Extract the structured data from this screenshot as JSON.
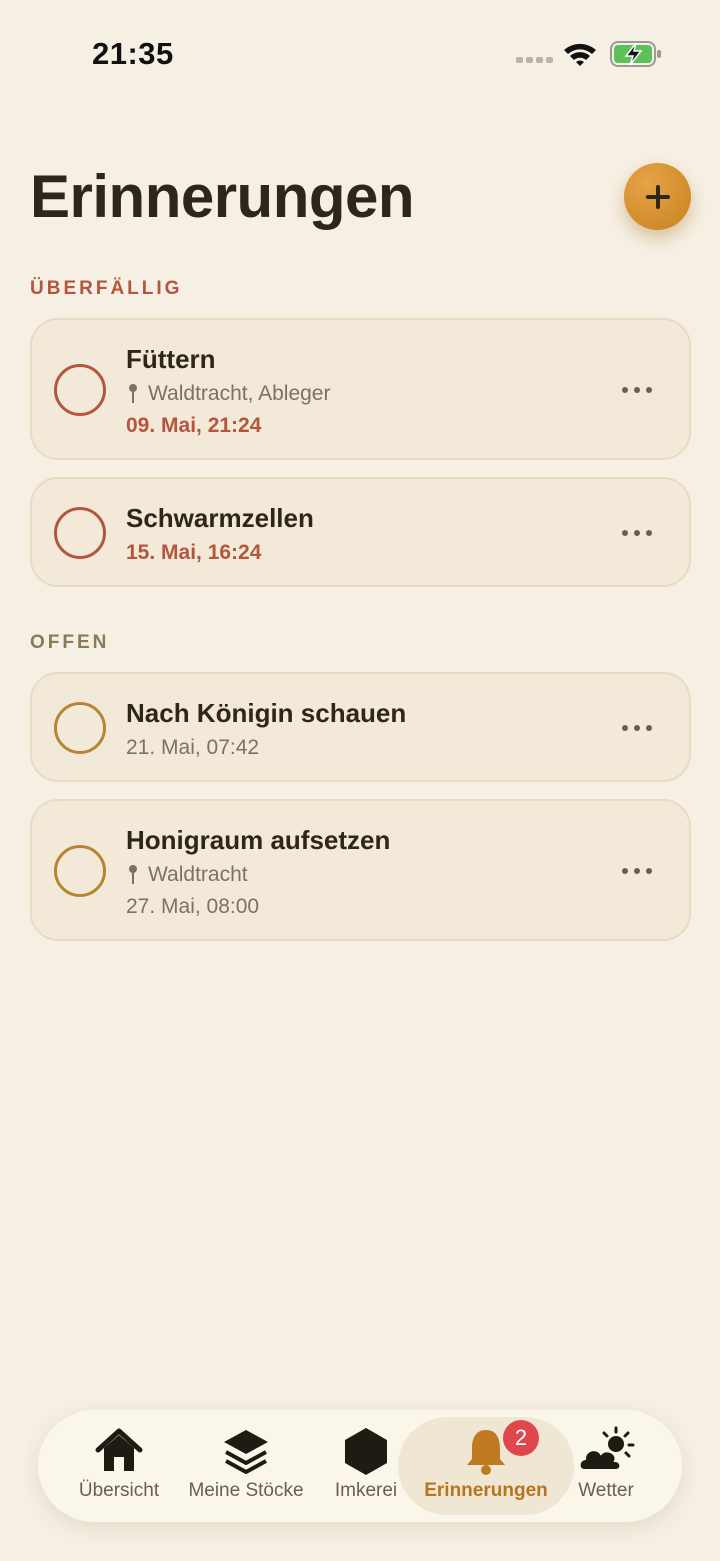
{
  "status_bar": {
    "time": "21:35"
  },
  "header": {
    "title": "Erinnerungen",
    "add_label": "+"
  },
  "sections": {
    "overdue": "ÜBERFÄLLIG",
    "open": "OFFEN"
  },
  "reminders": [
    {
      "title": "Füttern",
      "location": "Waldtracht, Ableger",
      "date": "09. Mai, 21:24",
      "status": "overdue"
    },
    {
      "title": "Schwarmzellen",
      "location": "",
      "date": "15. Mai, 16:24",
      "status": "overdue"
    },
    {
      "title": "Nach Königin schauen",
      "location": "",
      "date": "21. Mai, 07:42",
      "status": "open"
    },
    {
      "title": "Honigraum aufsetzen",
      "location": "Waldtracht",
      "date": "27. Mai, 08:00",
      "status": "open"
    }
  ],
  "tab_bar": {
    "items": [
      {
        "label": "Übersicht",
        "icon": "house-icon"
      },
      {
        "label": "Meine Stöcke",
        "icon": "layers-icon"
      },
      {
        "label": "Imkerei",
        "icon": "hexagon-icon"
      },
      {
        "label": "Erinnerungen",
        "icon": "bell-icon"
      },
      {
        "label": "Wetter",
        "icon": "cloud-sun-icon"
      }
    ],
    "active_index": 3,
    "badge": "2"
  },
  "colors": {
    "background": "#f6efe3",
    "accent": "#c7831f",
    "overdue": "#b4553e",
    "open": "#b7852e",
    "badge": "#e0474d"
  }
}
